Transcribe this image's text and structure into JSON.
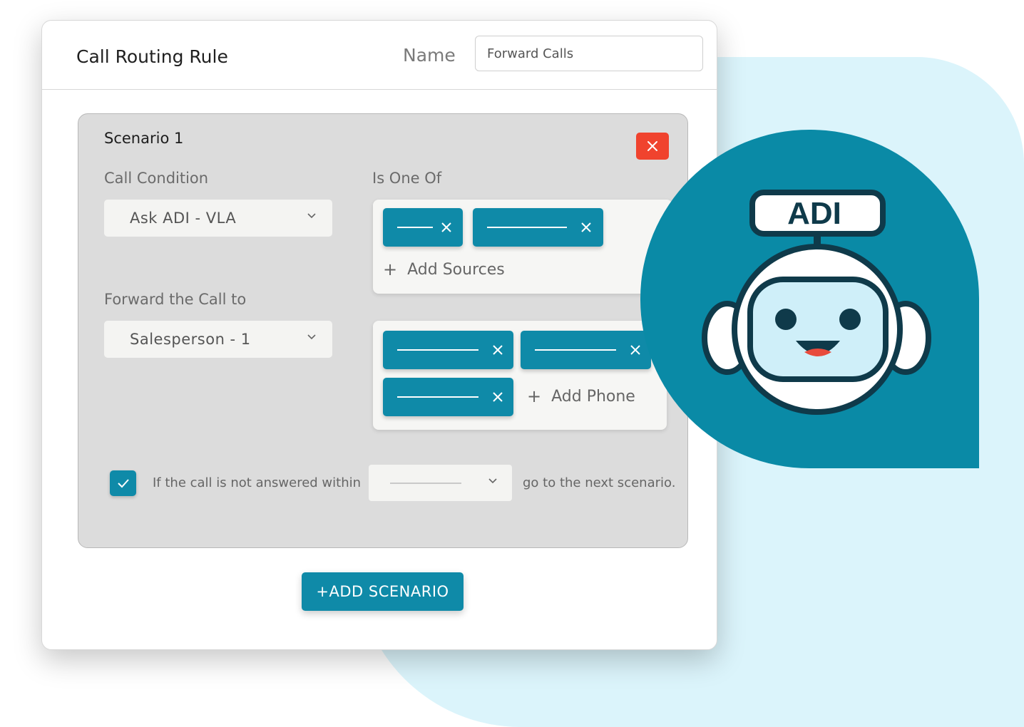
{
  "header": {
    "title": "Call Routing Rule",
    "name_label": "Name",
    "name_value": "Forward Calls"
  },
  "scenario": {
    "title": "Scenario 1",
    "call_condition_label": "Call Condition",
    "call_condition_value": "Ask ADI - VLA",
    "is_one_of_label": "Is One Of",
    "add_sources": "Add Sources",
    "forward_label": "Forward the Call to",
    "forward_value": "Salesperson - 1",
    "add_phone": "Add Phone",
    "timeout_prefix": "If the call is not answered within",
    "timeout_suffix": "go to the next scenario.",
    "timeout_checked": true
  },
  "add_scenario_label": "+ADD SCENARIO",
  "badge": {
    "label": "ADI"
  },
  "colors": {
    "accent": "#0f8aa8",
    "danger": "#f0432e",
    "robot_bg": "#0a8aa6",
    "blob": "#dbf4fb"
  }
}
